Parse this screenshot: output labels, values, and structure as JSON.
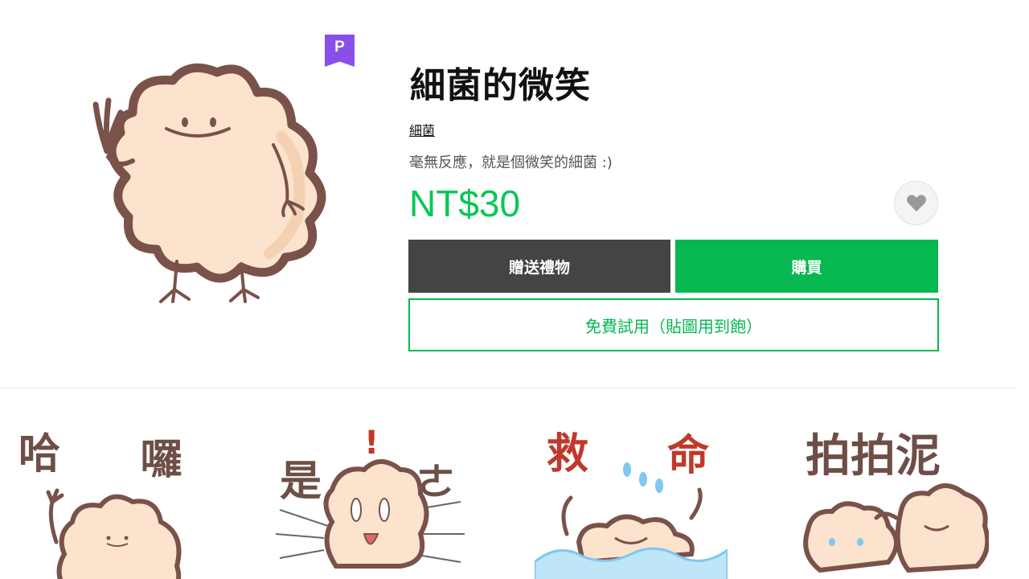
{
  "product": {
    "premium_badge": "P",
    "title": "細菌的微笑",
    "author": "細菌",
    "description": "毫無反應，就是個微笑的細菌 :)",
    "price": "NT$30"
  },
  "actions": {
    "gift_label": "贈送禮物",
    "buy_label": "購買",
    "trial_label": "免費試用（貼圖用到飽）",
    "favorite_icon": "heart-icon"
  },
  "stickers": [
    {
      "caption_left": "哈",
      "caption_right": "囉"
    },
    {
      "caption_left": "是",
      "caption_right": "ㄜ"
    },
    {
      "caption_left": "救",
      "caption_right": "命"
    },
    {
      "caption_left": "拍拍泥",
      "caption_right": ""
    }
  ],
  "colors": {
    "accent_green": "#06c755",
    "premium_purple": "#8a4fe8",
    "gift_gray": "#444444",
    "sticker_outline": "#7a524a",
    "sticker_fill": "#fbe3cd",
    "caption_red": "#c0392b",
    "caption_brown": "#6e4e47"
  }
}
